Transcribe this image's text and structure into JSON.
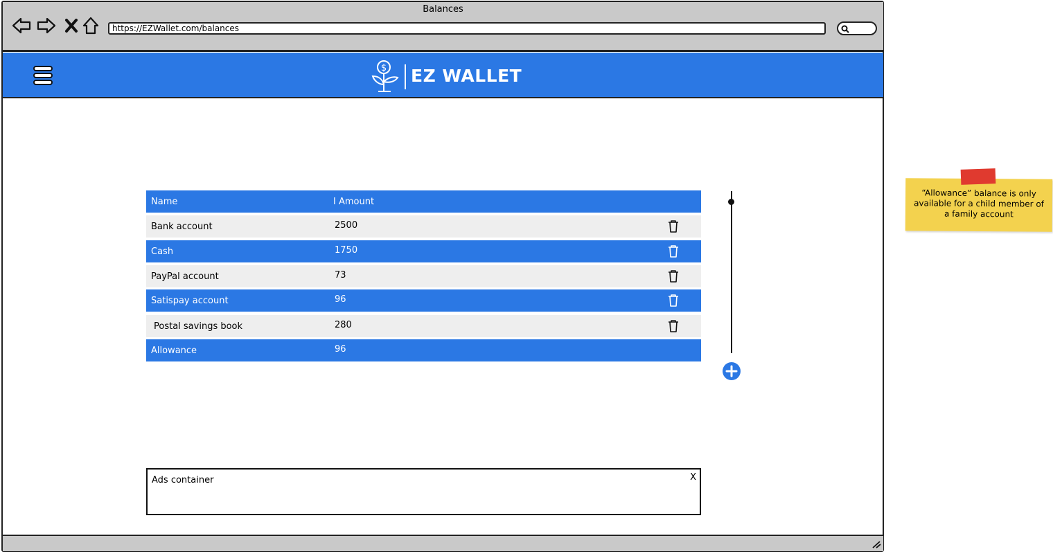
{
  "window": {
    "title": "Balances",
    "url": "https://EZWallet.com/balances"
  },
  "app": {
    "brand_name": "EZ WALLET",
    "brand_color": "#2b78e4"
  },
  "balances_table": {
    "headers": {
      "name": "Name",
      "amount": "I Amount"
    },
    "rows": [
      {
        "name": "Bank account",
        "amount": "2500",
        "deletable": true
      },
      {
        "name": "Cash",
        "amount": "1750",
        "deletable": true
      },
      {
        "name": "PayPal account",
        "amount": "73",
        "deletable": true
      },
      {
        "name": "Satispay account",
        "amount": "96",
        "deletable": true
      },
      {
        "name": "Postal savings book",
        "amount": "280",
        "deletable": true
      },
      {
        "name": "Allowance",
        "amount": "96",
        "deletable": false
      }
    ]
  },
  "ads": {
    "label": "Ads container",
    "close_label": "X"
  },
  "note": {
    "text": "“Allowance” balance is only available for a child member of a family account"
  },
  "icons": {
    "back": "back-arrow-icon",
    "forward": "forward-arrow-icon",
    "stop": "close-x-icon",
    "home": "home-icon",
    "search": "search-icon",
    "menu": "hamburger-menu-icon",
    "logo": "money-plant-icon",
    "delete": "trash-icon",
    "add": "plus-circle-icon"
  }
}
